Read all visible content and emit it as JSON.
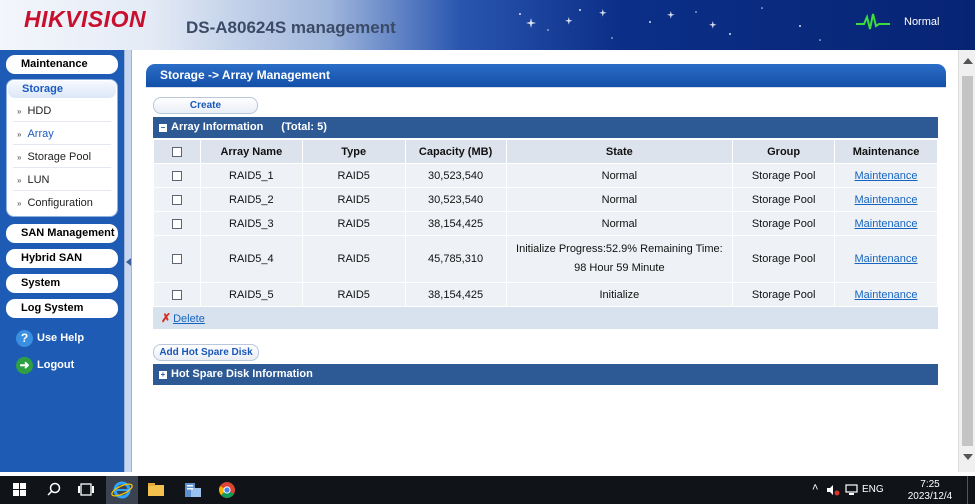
{
  "header": {
    "logo": "HIKVISION",
    "product_title": "DS-A80624S management",
    "status": "Normal",
    "colors": {
      "logo_red": "#c8102e",
      "status_green": "#3ddc3d",
      "header_blue": "#0b2f88"
    }
  },
  "sidebar": {
    "maintenance": "Maintenance",
    "storage": "Storage",
    "storage_items": [
      {
        "label": "HDD",
        "active": false
      },
      {
        "label": "Array",
        "active": true
      },
      {
        "label": "Storage Pool",
        "active": false
      },
      {
        "label": "LUN",
        "active": false
      },
      {
        "label": "Configuration",
        "active": false
      }
    ],
    "san_management": "SAN Management",
    "hybrid_san": "Hybrid SAN",
    "system": "System",
    "log_system": "Log System",
    "use_help": "Use Help",
    "logout": "Logout"
  },
  "content": {
    "breadcrumb": "Storage -> Array Management",
    "create_button": "Create",
    "array_section": {
      "title": "Array Information",
      "total": "(Total: 5)"
    },
    "columns": [
      "Array Name",
      "Type",
      "Capacity (MB)",
      "State",
      "Group",
      "Maintenance"
    ],
    "rows": [
      {
        "name": "RAID5_1",
        "type": "RAID5",
        "capacity": "30,523,540",
        "state": "Normal",
        "state_line2": "",
        "group": "Storage Pool",
        "maintenance": "Maintenance"
      },
      {
        "name": "RAID5_2",
        "type": "RAID5",
        "capacity": "30,523,540",
        "state": "Normal",
        "state_line2": "",
        "group": "Storage Pool",
        "maintenance": "Maintenance"
      },
      {
        "name": "RAID5_3",
        "type": "RAID5",
        "capacity": "38,154,425",
        "state": "Normal",
        "state_line2": "",
        "group": "Storage Pool",
        "maintenance": "Maintenance"
      },
      {
        "name": "RAID5_4",
        "type": "RAID5",
        "capacity": "45,785,310",
        "state": "Initialize Progress:52.9% Remaining Time:",
        "state_line2": "98 Hour 59 Minute",
        "group": "Storage Pool",
        "maintenance": "Maintenance"
      },
      {
        "name": "RAID5_5",
        "type": "RAID5",
        "capacity": "38,154,425",
        "state": "Initialize",
        "state_line2": "",
        "group": "Storage Pool",
        "maintenance": "Maintenance"
      }
    ],
    "delete_label": "Delete",
    "add_hot_spare_button": "Add Hot Spare Disk",
    "hot_spare_section": {
      "title": "Hot Spare Disk Information"
    }
  },
  "taskbar": {
    "language": "ENG",
    "time": "7:25",
    "date": "2023/12/4"
  }
}
